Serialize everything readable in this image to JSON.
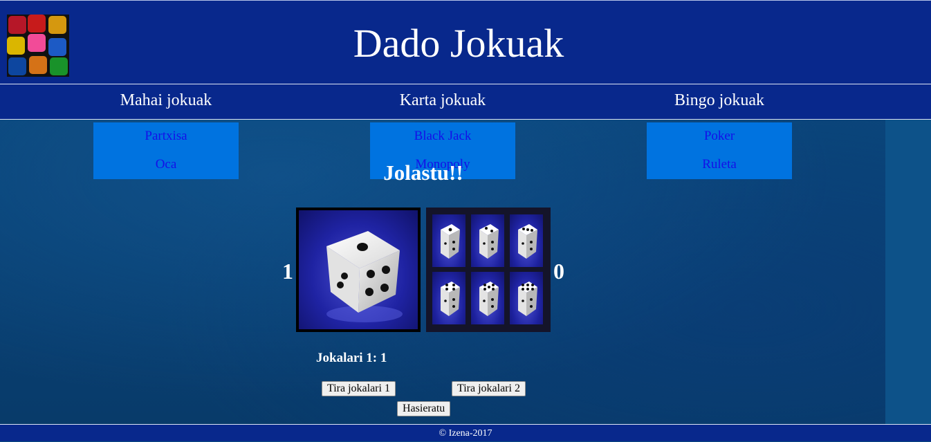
{
  "header": {
    "title": "Dado Jokuak"
  },
  "nav": {
    "categories": [
      {
        "label": "Mahai jokuak",
        "items": [
          "Partxisa",
          "Oca"
        ]
      },
      {
        "label": "Karta jokuak",
        "items": [
          "Black Jack",
          "Monopoly"
        ]
      },
      {
        "label": "Bingo jokuak",
        "items": [
          "Poker",
          "Ruleta"
        ]
      }
    ]
  },
  "game": {
    "heading": "Jolastu!!",
    "player1_score": "1",
    "player2_score": "0",
    "current_die_value": 1,
    "player_status": "Jokalari 1: 1",
    "buttons": {
      "roll_p1": "Tira jokalari 1",
      "roll_p2": "Tira jokalari 2",
      "reset": "Hasieratu"
    }
  },
  "footer": {
    "text": "© Izena-2017"
  },
  "colors": {
    "header_bg": "#08288c",
    "submenu_bg": "#0073e0",
    "submenu_link": "#1410e8"
  }
}
